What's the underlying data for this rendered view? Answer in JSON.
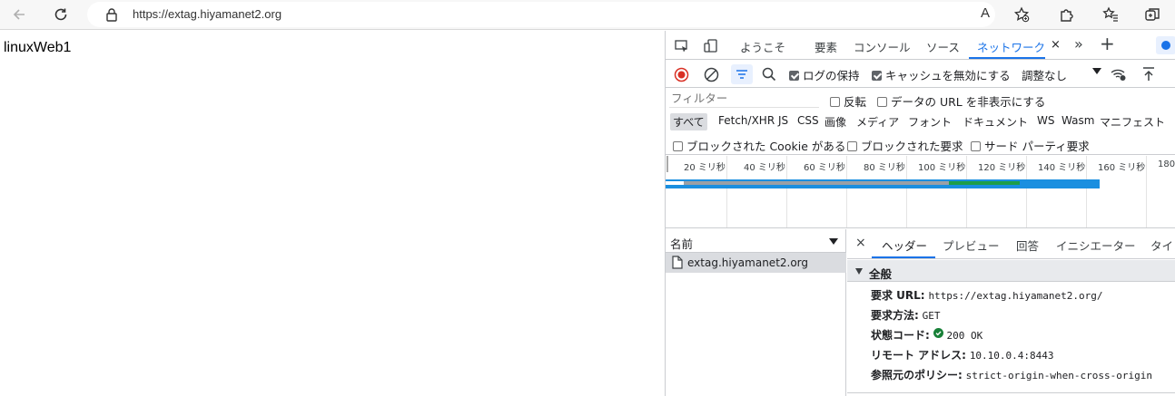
{
  "browser": {
    "url": "https://extag.hiyamanet2.org",
    "back_icon": "arrow-left-icon",
    "reload_icon": "reload-icon",
    "lock_icon": "lock-icon",
    "read_aloud_label": "A",
    "favorites_icon": "star-add-icon",
    "extensions_icon": "puzzle-icon",
    "collections_icon": "star-list-icon"
  },
  "page": {
    "text": "linuxWeb1"
  },
  "devtools": {
    "tabs": [
      {
        "label": "ようこそ"
      },
      {
        "label": "要素"
      },
      {
        "label": "コンソール"
      },
      {
        "label": "ソース"
      },
      {
        "label": "ネットワーク"
      }
    ],
    "active_tab_close": "×",
    "more_tabs": "»",
    "add_tab": "+",
    "toolbar": {
      "preserve_log": "ログの保持",
      "disable_cache": "キャッシュを無効にする",
      "throttle": "調整なし"
    },
    "filter": {
      "placeholder": "フィルター",
      "invert": "反転",
      "hide_data_urls": "データの URL を非表示にする"
    },
    "types": [
      "すべて",
      "Fetch/XHR",
      "JS",
      "CSS",
      "画像",
      "メディア",
      "フォント",
      "ドキュメント",
      "WS",
      "Wasm",
      "マニフェスト"
    ],
    "blocked": {
      "blocked_cookies": "ブロックされた Cookie がある",
      "blocked_requests": "ブロックされた要求",
      "third_party": "サード パーティ要求"
    },
    "timeline": {
      "ticks": [
        "20 ミリ秒",
        "40 ミリ秒",
        "60 ミリ秒",
        "80 ミリ秒",
        "100 ミリ秒",
        "120 ミリ秒",
        "140 ミリ秒",
        "160 ミリ秒",
        "180"
      ]
    },
    "names": {
      "header": "名前",
      "rows": [
        "extag.hiyamanet2.org"
      ]
    },
    "detail": {
      "close": "×",
      "tabs": [
        "ヘッダー",
        "プレビュー",
        "回答",
        "イニシエーター",
        "タイミ"
      ],
      "general_label": "全般",
      "headers": [
        {
          "key": "要求 URL:",
          "value": "https://extag.hiyamanet2.org/"
        },
        {
          "key": "要求方法:",
          "value": "GET"
        },
        {
          "key": "状態コード:",
          "value": "200 OK"
        },
        {
          "key": "リモート アドレス:",
          "value": "10.10.0.4:8443"
        },
        {
          "key": "参照元のポリシー:",
          "value": "strict-origin-when-cross-origin"
        }
      ]
    },
    "colors": {
      "accent": "#1a73e8",
      "record": "#d93025",
      "status_ok": "#188038"
    }
  }
}
